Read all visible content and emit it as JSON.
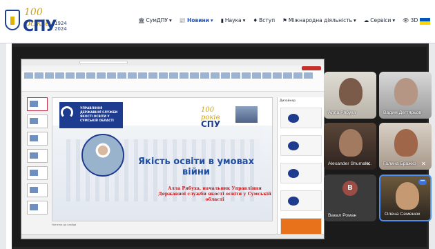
{
  "nav": {
    "logo": {
      "years": "100 років",
      "name": "СПУ",
      "range": "1924 2024"
    },
    "items": [
      {
        "label": "СумДПУ",
        "icon": "building-icon",
        "chevron": "▾",
        "active": false
      },
      {
        "label": "Новини",
        "icon": "newspaper-icon",
        "chevron": "▾",
        "active": true
      },
      {
        "label": "Наука",
        "icon": "book-icon",
        "chevron": "▾",
        "active": false
      },
      {
        "label": "Вступ",
        "icon": "person-icon",
        "chevron": "",
        "active": false
      },
      {
        "label": "Міжнародна діяльність",
        "icon": "flag-icon",
        "chevron": "▾",
        "active": false
      },
      {
        "label": "Сервіси",
        "icon": "cloud-icon",
        "chevron": "▾",
        "active": false
      },
      {
        "label": "3D тур",
        "icon": "eye-icon",
        "chevron": "",
        "active": false
      }
    ],
    "flag_colors": [
      "#0057b7",
      "#ffd700"
    ]
  },
  "presentation": {
    "org": "УПРАВЛІННЯ ДЕРЖАВНОЇ СЛУЖБИ ЯКОСТІ ОСВІТИ У СУМСЬКІЙ ОБЛАСТІ",
    "slide_logo_years": "100 років",
    "slide_logo_name": "СПУ",
    "title": "Якість освіти в умовах війни",
    "subtitle": "Алла Рябуха, начальник Управління Державної служби якості освіти у Сумській області",
    "panel_title": "Дизайнер",
    "notes_hint": "Нотатки до слайда"
  },
  "participants": [
    {
      "name": "Алла Рябуха",
      "muted": false
    },
    {
      "name": "Вадим Дегтярьов",
      "muted": false
    },
    {
      "name": "Alexander Shumak...",
      "muted": true
    },
    {
      "name": "Галина Бражко",
      "muted": true
    },
    {
      "name": "Вакал Роман",
      "muted": true,
      "initial": "В"
    },
    {
      "name": "Олена Семенюк",
      "muted": false
    }
  ]
}
